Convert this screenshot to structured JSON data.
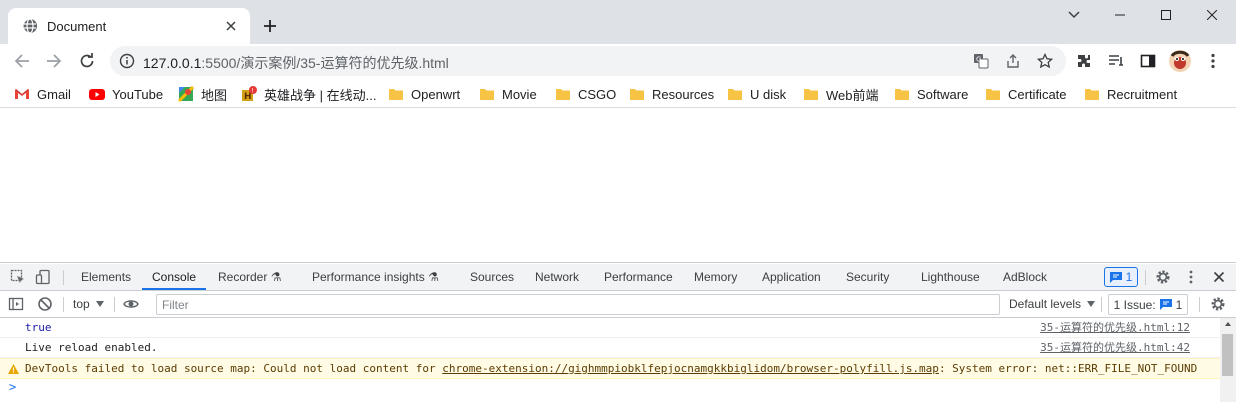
{
  "tab": {
    "title": "Document"
  },
  "address_bar": {
    "host": "127.0.0.1",
    "rest": ":5500/演示案例/35-运算符的优先级.html"
  },
  "bookmarks": [
    {
      "label": "Gmail",
      "icon": "gmail-icon"
    },
    {
      "label": "YouTube",
      "icon": "youtube-icon"
    },
    {
      "label": "地图",
      "icon": "maps-icon"
    },
    {
      "label": "英雄战争 | 在线动...",
      "icon": "game-icon"
    },
    {
      "label": "Openwrt",
      "icon": "folder-icon"
    },
    {
      "label": "Movie",
      "icon": "folder-icon"
    },
    {
      "label": "CSGO",
      "icon": "folder-icon"
    },
    {
      "label": "Resources",
      "icon": "folder-icon"
    },
    {
      "label": "U disk",
      "icon": "folder-icon"
    },
    {
      "label": "Web前端",
      "icon": "folder-icon"
    },
    {
      "label": "Software",
      "icon": "folder-icon"
    },
    {
      "label": "Certificate",
      "icon": "folder-icon"
    },
    {
      "label": "Recruitment",
      "icon": "folder-icon"
    }
  ],
  "devtools": {
    "tabs": [
      "Elements",
      "Console",
      "Recorder",
      "Performance insights",
      "Sources",
      "Network",
      "Performance",
      "Memory",
      "Application",
      "Security",
      "Lighthouse",
      "AdBlock"
    ],
    "active_tab": "Console",
    "issue_count": "1",
    "context": "top",
    "filter_placeholder": "Filter",
    "levels_label": "Default levels",
    "issues_label": "1 Issue:",
    "issues_count": "1"
  },
  "console": {
    "messages": [
      {
        "text": "true",
        "source": "35-运算符的优先级.html:12",
        "kind": "value"
      },
      {
        "text": "Live reload enabled.",
        "source": "35-运算符的优先级.html:42",
        "kind": "log"
      }
    ],
    "warning": {
      "prefix": "DevTools failed to load source map: Could not load content for ",
      "link": "chrome-extension://gighmmpiobklfepjocnamgkkbiglidom/browser-polyfill.js.map",
      "suffix": ": System error: net::ERR_FILE_NOT_FOUND"
    },
    "prompt": ">"
  },
  "colors": {
    "accent": "#1a73e8",
    "tabstrip": "#dee1e6",
    "warning_bg": "#fffbe5",
    "folder": "#f6c344"
  }
}
